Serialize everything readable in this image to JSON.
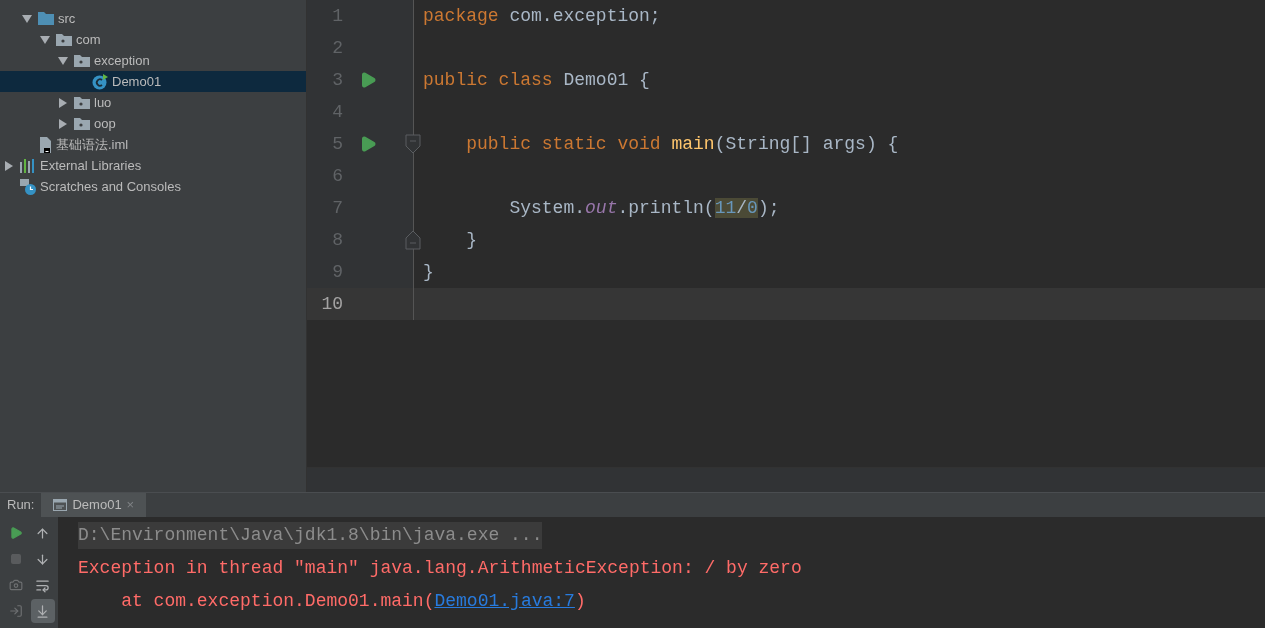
{
  "project_tree": [
    {
      "kind": "project_contents",
      "children": [
        {
          "kind": "source_folder",
          "label": "src",
          "expanded": true,
          "selected": false,
          "children": [
            {
              "kind": "package",
              "label": "com",
              "expanded": true,
              "selected": false,
              "children": [
                {
                  "kind": "package",
                  "label": "exception",
                  "expanded": true,
                  "selected": false,
                  "children": [
                    {
                      "kind": "class",
                      "label": "Demo01",
                      "selected": true
                    }
                  ]
                },
                {
                  "kind": "package",
                  "label": "luo",
                  "expanded": false,
                  "selected": false
                },
                {
                  "kind": "package",
                  "label": "oop",
                  "expanded": false,
                  "selected": false
                }
              ]
            }
          ]
        },
        {
          "kind": "module_file",
          "label": "基础语法.iml",
          "selected": false
        }
      ]
    },
    {
      "kind": "libraries",
      "label": "External Libraries",
      "expanded": false,
      "selected": false
    },
    {
      "kind": "scratches",
      "label": "Scratches and Consoles",
      "selected": false
    }
  ],
  "editor": {
    "lines": [
      {
        "number": "1",
        "run": false,
        "fold_start": false,
        "fold_end": false,
        "current": false,
        "tokens": [
          {
            "kind": "keyword",
            "text": "package"
          },
          {
            "kind": "plain",
            "text": " com.exception;"
          }
        ]
      },
      {
        "number": "2",
        "run": false,
        "fold_start": false,
        "fold_end": false,
        "current": false
      },
      {
        "number": "3",
        "run": true,
        "fold_start": false,
        "fold_end": false,
        "current": false,
        "tokens": [
          {
            "kind": "keyword",
            "text": "public class"
          },
          {
            "kind": "plain",
            "text": " Demo01 {"
          }
        ]
      },
      {
        "number": "4",
        "run": false,
        "fold_start": false,
        "fold_end": false,
        "current": false
      },
      {
        "number": "5",
        "run": true,
        "fold_start": true,
        "fold_end": false,
        "current": false,
        "tokens": [
          {
            "kind": "keyword",
            "text": "    public static void "
          },
          {
            "kind": "method",
            "text": "main"
          },
          {
            "kind": "plain",
            "text": "(String[] args) {"
          }
        ]
      },
      {
        "number": "6",
        "run": false,
        "fold_start": false,
        "fold_end": false,
        "current": false
      },
      {
        "number": "7",
        "run": false,
        "fold_start": false,
        "fold_end": false,
        "current": false,
        "tokens": [
          {
            "kind": "plain",
            "text": "        System."
          },
          {
            "kind": "field",
            "text": "out"
          },
          {
            "kind": "plain",
            "text": ".println("
          },
          {
            "kind": "highlight",
            "tokens": [
              {
                "kind": "number",
                "text": "11"
              },
              {
                "kind": "plain",
                "text": "/"
              },
              {
                "kind": "number",
                "text": "0"
              }
            ]
          },
          {
            "kind": "plain",
            "text": ");"
          }
        ]
      },
      {
        "number": "8",
        "run": false,
        "fold_start": false,
        "fold_end": true,
        "current": false,
        "tokens": [
          {
            "kind": "plain",
            "text": "    }"
          }
        ]
      },
      {
        "number": "9",
        "run": false,
        "fold_start": false,
        "fold_end": false,
        "current": false,
        "tokens": [
          {
            "kind": "plain",
            "text": "}"
          }
        ]
      },
      {
        "number": "10",
        "run": false,
        "fold_start": false,
        "fold_end": false,
        "current": true
      }
    ]
  },
  "run_panel": {
    "label": "Run:",
    "tabs": [
      {
        "label": "Demo01",
        "close": "×",
        "selected": true
      }
    ],
    "scroll_to_end_on": true,
    "stop_disabled": true,
    "console": [
      {
        "kind": "command",
        "text": "D:\\Environment\\Java\\jdk1.8\\bin\\java.exe ..."
      },
      {
        "kind": "error",
        "text": "Exception in thread \"main\" java.lang.ArithmeticException: / by zero"
      },
      {
        "kind": "stack",
        "text": "    at com.exception.Demo01.main(",
        "link": "Demo01.java:7",
        "after": ")"
      }
    ]
  }
}
